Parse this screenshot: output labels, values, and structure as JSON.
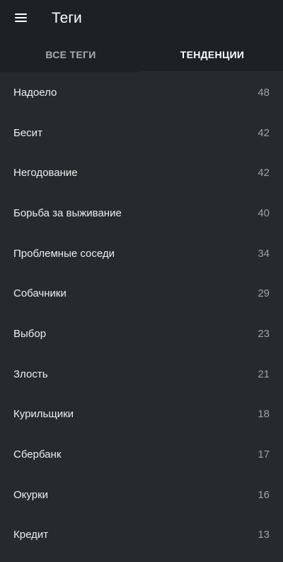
{
  "appbar": {
    "title": "Теги"
  },
  "tabs": [
    {
      "label": "ВСЕ ТЕГИ",
      "active": false
    },
    {
      "label": "ТЕНДЕНЦИИ",
      "active": true
    }
  ],
  "tags": [
    {
      "label": "Надоело",
      "count": "48"
    },
    {
      "label": "Бесит",
      "count": "42"
    },
    {
      "label": "Негодование",
      "count": "42"
    },
    {
      "label": "Борьба за выживание",
      "count": "40"
    },
    {
      "label": "Проблемные соседи",
      "count": "34"
    },
    {
      "label": "Собачники",
      "count": "29"
    },
    {
      "label": "Выбор",
      "count": "23"
    },
    {
      "label": "Злость",
      "count": "21"
    },
    {
      "label": "Курильщики",
      "count": "18"
    },
    {
      "label": "Сбербанк",
      "count": "17"
    },
    {
      "label": "Окурки",
      "count": "16"
    },
    {
      "label": "Кредит",
      "count": "13"
    }
  ]
}
